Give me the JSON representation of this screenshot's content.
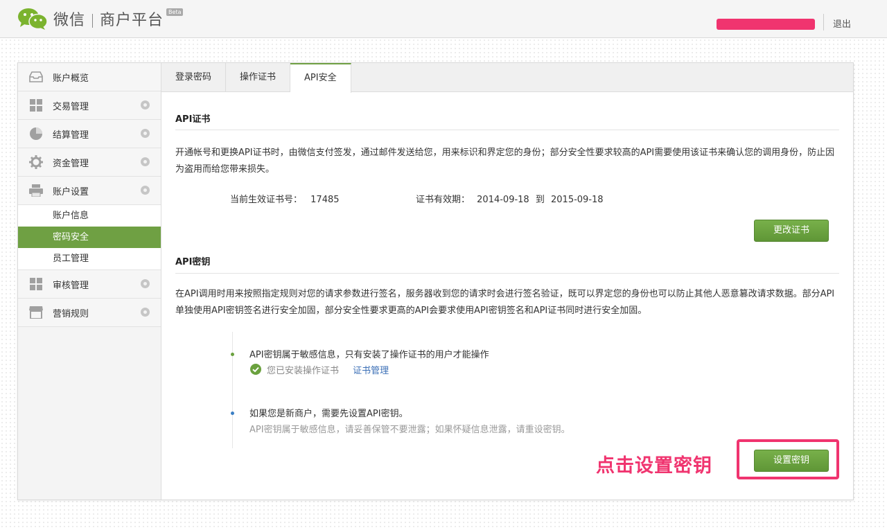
{
  "header": {
    "brand": "微信",
    "platform": "商户平台",
    "beta": "Beta",
    "logout": "退出"
  },
  "sidebar": {
    "items": [
      {
        "label": "账户概览",
        "icon": "inbox-icon"
      },
      {
        "label": "交易管理",
        "icon": "grid-icon"
      },
      {
        "label": "结算管理",
        "icon": "pie-chart-icon"
      },
      {
        "label": "资金管理",
        "icon": "gear-icon"
      },
      {
        "label": "账户设置",
        "icon": "printer-icon"
      },
      {
        "label": "审核管理",
        "icon": "grid-icon"
      },
      {
        "label": "营销规则",
        "icon": "shop-icon"
      }
    ],
    "sub_items": [
      "账户信息",
      "密码安全",
      "员工管理"
    ],
    "active_sub": "密码安全"
  },
  "tabs": [
    "登录密码",
    "操作证书",
    "API安全"
  ],
  "active_tab": "API安全",
  "cert": {
    "title": "API证书",
    "desc": "开通帐号和更换API证书时，由微信支付签发，通过邮件发送给您，用来标识和界定您的身份；部分安全性要求较高的API需要使用该证书来确认您的调用身份，防止因为盗用而给您带来损失。",
    "current_label": "当前生效证书号：",
    "current_value": "17485",
    "valid_label": "证书有效期：",
    "valid_from": "2014-09-18",
    "valid_to_word": "到",
    "valid_to": "2015-09-18",
    "change_button": "更改证书"
  },
  "key": {
    "title": "API密钥",
    "desc": "在API调用时用来按照指定规则对您的请求参数进行签名，服务器收到您的请求时会进行签名验证，既可以界定您的身份也可以防止其他人恶意篡改请求数据。部分API单独使用API密钥签名进行安全加固，部分安全性要求更高的API会要求使用API密钥签名和API证书同时进行安全加固。",
    "note1": "API密钥属于敏感信息，只有安装了操作证书的用户才能操作",
    "note1_status": "您已安装操作证书",
    "note1_link": "证书管理",
    "note2": "如果您是新商户，需要先设置API密钥。",
    "note2_sub": "API密钥属于敏感信息，请妥善保管不要泄露；如果怀疑信息泄露，请重设密钥。",
    "set_button": "设置密钥"
  },
  "annotation": "点击设置密钥",
  "colors": {
    "accent_green": "#6aa13e",
    "annotation_pink": "#f0346f",
    "link_blue": "#3b6fb6"
  }
}
